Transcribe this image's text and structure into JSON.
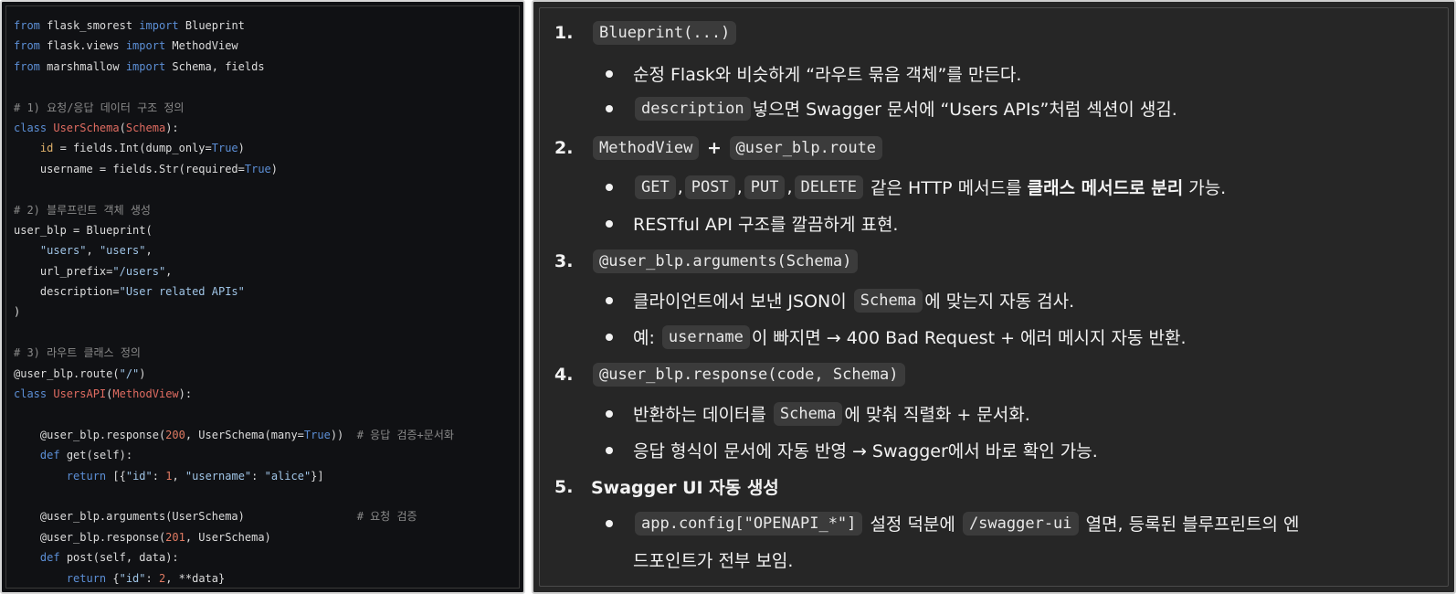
{
  "code_lines": [
    [
      {
        "t": "from",
        "c": "kw"
      },
      {
        "t": " flask_smorest "
      },
      {
        "t": "import",
        "c": "kw"
      },
      {
        "t": " Blueprint"
      }
    ],
    [
      {
        "t": "from",
        "c": "kw"
      },
      {
        "t": " flask.views "
      },
      {
        "t": "import",
        "c": "kw"
      },
      {
        "t": " MethodView"
      }
    ],
    [
      {
        "t": "from",
        "c": "kw"
      },
      {
        "t": " marshmallow "
      },
      {
        "t": "import",
        "c": "kw"
      },
      {
        "t": " Schema, fields"
      }
    ],
    [],
    [
      {
        "t": "# 1) 요청/응답 데이터 구조 정의",
        "c": "cmt"
      }
    ],
    [
      {
        "t": "class",
        "c": "kw"
      },
      {
        "t": " "
      },
      {
        "t": "UserSchema",
        "c": "cls"
      },
      {
        "t": "("
      },
      {
        "t": "Schema",
        "c": "cls"
      },
      {
        "t": "):"
      }
    ],
    [
      {
        "t": "    "
      },
      {
        "t": "id",
        "c": "attr"
      },
      {
        "t": " = fields.Int(dump_only="
      },
      {
        "t": "True",
        "c": "kw"
      },
      {
        "t": ")"
      }
    ],
    [
      {
        "t": "    username = fields.Str(required="
      },
      {
        "t": "True",
        "c": "kw"
      },
      {
        "t": ")"
      }
    ],
    [],
    [
      {
        "t": "# 2) 블루프린트 객체 생성",
        "c": "cmt"
      }
    ],
    [
      {
        "t": "user_blp = Blueprint("
      }
    ],
    [
      {
        "t": "    "
      },
      {
        "t": "\"users\"",
        "c": "str"
      },
      {
        "t": ", "
      },
      {
        "t": "\"users\"",
        "c": "str"
      },
      {
        "t": ","
      }
    ],
    [
      {
        "t": "    url_prefix="
      },
      {
        "t": "\"/users\"",
        "c": "str"
      },
      {
        "t": ","
      }
    ],
    [
      {
        "t": "    description="
      },
      {
        "t": "\"User related APIs\"",
        "c": "str"
      }
    ],
    [
      {
        "t": ")"
      }
    ],
    [],
    [
      {
        "t": "# 3) 라우트 클래스 정의",
        "c": "cmt"
      }
    ],
    [
      {
        "t": "@user_blp.route("
      },
      {
        "t": "\"/\"",
        "c": "str"
      },
      {
        "t": ")"
      }
    ],
    [
      {
        "t": "class",
        "c": "kw"
      },
      {
        "t": " "
      },
      {
        "t": "UsersAPI",
        "c": "cls"
      },
      {
        "t": "("
      },
      {
        "t": "MethodView",
        "c": "cls"
      },
      {
        "t": "):"
      }
    ],
    [],
    [
      {
        "t": "    @user_blp.response("
      },
      {
        "t": "200",
        "c": "num"
      },
      {
        "t": ", UserSchema(many="
      },
      {
        "t": "True",
        "c": "kw"
      },
      {
        "t": "))  "
      },
      {
        "t": "# 응답 검증+문서화",
        "c": "cmt"
      }
    ],
    [
      {
        "t": "    "
      },
      {
        "t": "def",
        "c": "kw"
      },
      {
        "t": " get(self):"
      }
    ],
    [
      {
        "t": "        "
      },
      {
        "t": "return",
        "c": "kw"
      },
      {
        "t": " [{"
      },
      {
        "t": "\"id\"",
        "c": "str"
      },
      {
        "t": ": "
      },
      {
        "t": "1",
        "c": "num"
      },
      {
        "t": ", "
      },
      {
        "t": "\"username\"",
        "c": "str"
      },
      {
        "t": ": "
      },
      {
        "t": "\"alice\"",
        "c": "str"
      },
      {
        "t": "}]"
      }
    ],
    [],
    [
      {
        "t": "    @user_blp.arguments(UserSchema)                 "
      },
      {
        "t": "# 요청 검증",
        "c": "cmt"
      }
    ],
    [
      {
        "t": "    @user_blp.response("
      },
      {
        "t": "201",
        "c": "num"
      },
      {
        "t": ", UserSchema)"
      }
    ],
    [
      {
        "t": "    "
      },
      {
        "t": "def",
        "c": "kw"
      },
      {
        "t": " post(self, data):"
      }
    ],
    [
      {
        "t": "        "
      },
      {
        "t": "return",
        "c": "kw"
      },
      {
        "t": " {"
      },
      {
        "t": "\"id\"",
        "c": "str"
      },
      {
        "t": ": "
      },
      {
        "t": "2",
        "c": "num"
      },
      {
        "t": ", **data}"
      }
    ]
  ],
  "notes": {
    "s1": {
      "num": "1.",
      "chip": "Blueprint(...)"
    },
    "s1b1": {
      "text": "순정 Flask와 비슷하게 “라우트 묶음 객체”를 만든다."
    },
    "s1b2": {
      "chip": "description",
      "text": " 넣으면 Swagger 문서에 “Users APIs”처럼 섹션이 생김."
    },
    "s2": {
      "num": "2.",
      "chip1": "MethodView",
      "plus": " + ",
      "chip2": "@user_blp.route"
    },
    "s2b1": {
      "chips": [
        "GET",
        "POST",
        "PUT",
        "DELETE"
      ],
      "sep": ",",
      "text1": " 같은 HTTP 메서드를 ",
      "bold": "클래스 메서드로 분리",
      "text2": " 가능."
    },
    "s2b2": {
      "text": "RESTful API 구조를 깔끔하게 표현."
    },
    "s3": {
      "num": "3.",
      "chip": "@user_blp.arguments(Schema)"
    },
    "s3b1": {
      "text1": "클라이언트에서 보낸 JSON이 ",
      "chip": "Schema",
      "text2": "에 맞는지 자동 검사."
    },
    "s3b2": {
      "text1": "예: ",
      "chip": "username",
      "text2": "이 빠지면 → 400 Bad Request + 에러 메시지 자동 반환."
    },
    "s4": {
      "num": "4.",
      "chip": "@user_blp.response(code, Schema)"
    },
    "s4b1": {
      "text1": "반환하는 데이터를 ",
      "chip": "Schema",
      "text2": "에 맞춰 직렬화 + 문서화."
    },
    "s4b2": {
      "text": "응답 형식이 문서에 자동 반영 → Swagger에서 바로 확인 가능."
    },
    "s5": {
      "num": "5.",
      "title": "Swagger UI 자동 생성"
    },
    "s5b1": {
      "chip1": "app.config[\"OPENAPI_*\"]",
      "text1": " 설정 덕분에 ",
      "chip2": "/swagger-ui",
      "text2": " 열면, 등록된 블루프린트의 엔",
      "text3": "드포인트가 전부 보임."
    }
  }
}
